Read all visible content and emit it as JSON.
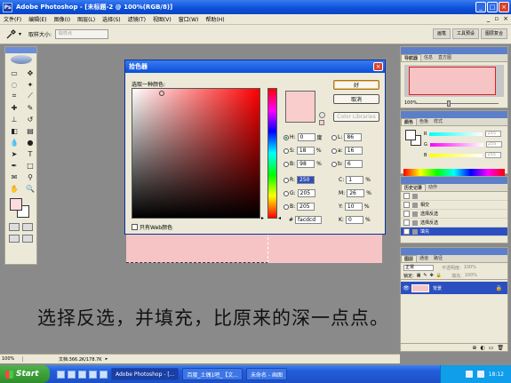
{
  "window": {
    "app_badge": "Ps",
    "title": "Adobe Photoshop - [未标题-2 @ 100%(RGB/8)]",
    "min": "_",
    "max": "□",
    "close": "×",
    "doc_min": "_",
    "doc_restore": "▫",
    "doc_close": "×"
  },
  "menu": [
    "文件(F)",
    "编辑(E)",
    "图像(I)",
    "图层(L)",
    "选择(S)",
    "滤镜(T)",
    "视图(V)",
    "窗口(W)",
    "帮助(H)"
  ],
  "options": {
    "tool_icon": "eyedropper-icon",
    "caret": "▾",
    "sample_label": "取样大小:",
    "sample_value": "取样点",
    "well_tabs": [
      "画笔",
      "工具预设",
      "图层复合"
    ]
  },
  "picker": {
    "title": "拾色器",
    "close": "×",
    "select_label": "选取一种颜色:",
    "ok": "好",
    "cancel": "取消",
    "libraries": "Color Libraries",
    "web_only": "只有Web颜色",
    "hue_marker": "▸",
    "hue_marker_right": "◂",
    "new_color": "#facdcd",
    "fields": {
      "H": {
        "label": "H:",
        "value": "0",
        "unit": "度"
      },
      "S": {
        "label": "S:",
        "value": "18",
        "unit": "%"
      },
      "Bv": {
        "label": "B:",
        "value": "98",
        "unit": "%"
      },
      "R": {
        "label": "R:",
        "value": "250",
        "unit": ""
      },
      "G": {
        "label": "G:",
        "value": "205",
        "unit": ""
      },
      "B": {
        "label": "B:",
        "value": "205",
        "unit": ""
      },
      "L": {
        "label": "L:",
        "value": "86",
        "unit": ""
      },
      "a": {
        "label": "a:",
        "value": "16",
        "unit": ""
      },
      "b": {
        "label": "b:",
        "value": "6",
        "unit": ""
      },
      "C": {
        "label": "C:",
        "value": "1",
        "unit": "%"
      },
      "M": {
        "label": "M:",
        "value": "26",
        "unit": "%"
      },
      "Y": {
        "label": "Y:",
        "value": "10",
        "unit": "%"
      },
      "K": {
        "label": "K:",
        "value": "0",
        "unit": "%"
      },
      "hex_label": "#",
      "hex": "facdcd"
    }
  },
  "navigator": {
    "tabs": [
      "导航器",
      "信息",
      "直方图"
    ],
    "zoom": "100%"
  },
  "color_panel": {
    "tabs": [
      "颜色",
      "色板",
      "样式"
    ],
    "rows": [
      {
        "label": "R",
        "value": "255",
        "gradient": "linear-gradient(to right,#00ffff,#ffffff)"
      },
      {
        "label": "G",
        "value": "255",
        "gradient": "linear-gradient(to right,#ff00ff,#ffffff)"
      },
      {
        "label": "B",
        "value": "255",
        "gradient": "linear-gradient(to right,#ffff00,#ffffff)"
      }
    ]
  },
  "history": {
    "tabs": [
      "历史记录",
      "动作"
    ],
    "items": [
      {
        "label": "",
        "selected": false
      },
      {
        "label": "相交",
        "selected": false
      },
      {
        "label": "选择反选",
        "selected": false
      },
      {
        "label": "选择反选",
        "selected": false
      },
      {
        "label": "填充",
        "selected": true
      }
    ]
  },
  "layers": {
    "tabs": [
      "图层",
      "通道",
      "路径"
    ],
    "mode": "正常",
    "opacity_label": "不透明度:",
    "opacity": "100%",
    "lock_label": "锁定:",
    "fill_label": "填充:",
    "fill": "100%",
    "layer_name": "背景",
    "eye": "👁",
    "lock": "🔒",
    "footer_icons": [
      "⊕",
      "◐",
      "▭",
      "🗑"
    ]
  },
  "caption": "选择反选，并填充，比原来的深一点点。",
  "status": {
    "zoom": "100%",
    "doc": "文档:366.2K/178.7K",
    "arrow": "▸"
  },
  "taskbar": {
    "start": "Start",
    "tasks": [
      {
        "label": "Adobe Photoshop - [...",
        "active": true
      },
      {
        "label": "百度_土偶1吧_【文...",
        "active": false
      },
      {
        "label": "未命名 - 画图",
        "active": false
      }
    ],
    "clock": "18:12"
  },
  "colors": {
    "fg_swatch": "#fcdcdc",
    "canvas_fill": "#f6c4c4",
    "selection": "#2c4fc0"
  }
}
